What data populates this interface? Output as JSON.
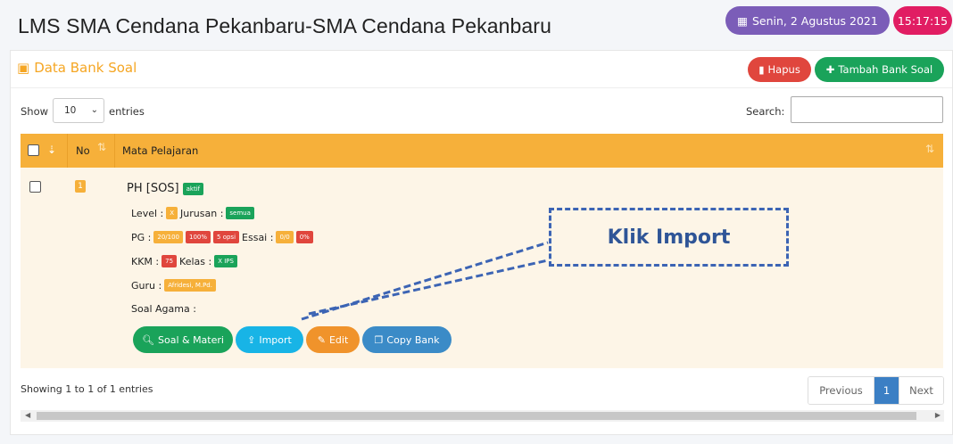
{
  "header": {
    "title": "LMS SMA Cendana Pekanbaru-SMA Cendana Pekanbaru",
    "date": "Senin, 2 Agustus 2021",
    "time": "15:17:15"
  },
  "card": {
    "title": "Data Bank Soal",
    "hapus_label": "Hapus",
    "tambah_label": "Tambah Bank Soal"
  },
  "controls": {
    "show_label": "Show",
    "entries_value": "10",
    "entries_label": "entries",
    "search_label": "Search:",
    "search_value": ""
  },
  "table": {
    "col_no": "No",
    "col_mapel": "Mata Pelajaran",
    "rows": [
      {
        "no": "1",
        "subject": "PH [SOS]",
        "status": "aktif",
        "level_label": "Level :",
        "level": "X",
        "jurusan_label": "Jurusan :",
        "jurusan": "semua",
        "pg_label": "PG :",
        "pg_count": "20/100",
        "pg_pct": "100%",
        "pg_opsi": "5 opsi",
        "essai_label": "Essai :",
        "essai_count": "0/0",
        "essai_pct": "0%",
        "kkm_label": "KKM :",
        "kkm": "75",
        "kelas_label": "Kelas :",
        "kelas": "X IPS",
        "guru_label": "Guru :",
        "guru": "Afridesi, M.Pd.",
        "agama_label": "Soal Agama :",
        "actions": {
          "soal": "Soal & Materi",
          "import": "Import",
          "edit": "Edit",
          "copy": "Copy Bank"
        }
      }
    ]
  },
  "annotation": {
    "text": "Klik Import",
    "color": "#3c64b4"
  },
  "footer": {
    "info": "Showing 1 to 1 of 1 entries",
    "prev": "Previous",
    "page": "1",
    "next": "Next"
  },
  "colors": {
    "accent": "#f6b03a",
    "green": "#1aa35a",
    "red": "#e0463d",
    "purple": "#7b5db8",
    "pink": "#e11d63"
  }
}
